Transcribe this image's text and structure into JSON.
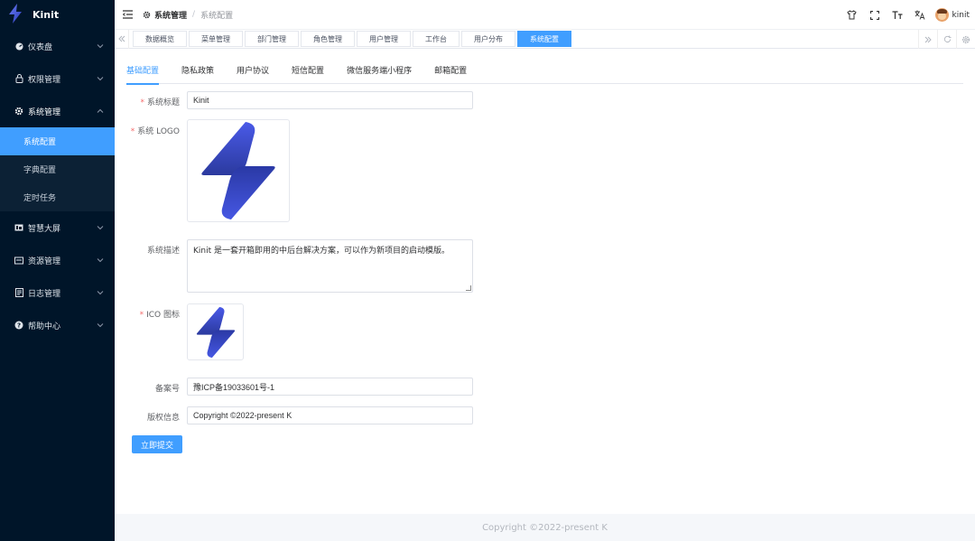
{
  "brand": {
    "name": "Kinit"
  },
  "sidebar": {
    "items": [
      {
        "label": "仪表盘",
        "icon": "dashboard-icon"
      },
      {
        "label": "权限管理",
        "icon": "lock-icon"
      },
      {
        "label": "系统管理",
        "icon": "gear-icon"
      },
      {
        "label": "智慧大屏",
        "icon": "screen-icon"
      },
      {
        "label": "资源管理",
        "icon": "folder-icon"
      },
      {
        "label": "日志管理",
        "icon": "document-icon"
      },
      {
        "label": "帮助中心",
        "icon": "help-icon"
      }
    ],
    "subitems": [
      {
        "label": "系统配置"
      },
      {
        "label": "字典配置"
      },
      {
        "label": "定时任务"
      }
    ]
  },
  "header": {
    "breadcrumb_parent": "系统管理",
    "breadcrumb_current": "系统配置",
    "username": "kinit"
  },
  "tabs": [
    {
      "label": "数据概览"
    },
    {
      "label": "菜单管理"
    },
    {
      "label": "部门管理"
    },
    {
      "label": "角色管理"
    },
    {
      "label": "用户管理"
    },
    {
      "label": "工作台"
    },
    {
      "label": "用户分布"
    },
    {
      "label": "系统配置"
    }
  ],
  "subtabs": [
    {
      "label": "基础配置"
    },
    {
      "label": "隐私政策"
    },
    {
      "label": "用户协议"
    },
    {
      "label": "短信配置"
    },
    {
      "label": "微信服务端小程序"
    },
    {
      "label": "邮箱配置"
    }
  ],
  "form": {
    "title_label": "系统标题",
    "title_value": "Kinit",
    "logo_label": "系统 LOGO",
    "desc_label": "系统描述",
    "desc_value": "Kinit 是一套开箱即用的中后台解决方案，可以作为新项目的启动模版。",
    "ico_label": "ICO 图标",
    "icp_label": "备案号",
    "icp_value": "豫ICP备19033601号-1",
    "copyright_label": "版权信息",
    "copyright_value": "Copyright ©2022-present K",
    "submit_label": "立即提交"
  },
  "footer": {
    "text": "Copyright ©2022-present K"
  },
  "colors": {
    "accent": "#409eff",
    "sidebar_bg": "#001529",
    "logo_blue": "#3a4fd8"
  }
}
